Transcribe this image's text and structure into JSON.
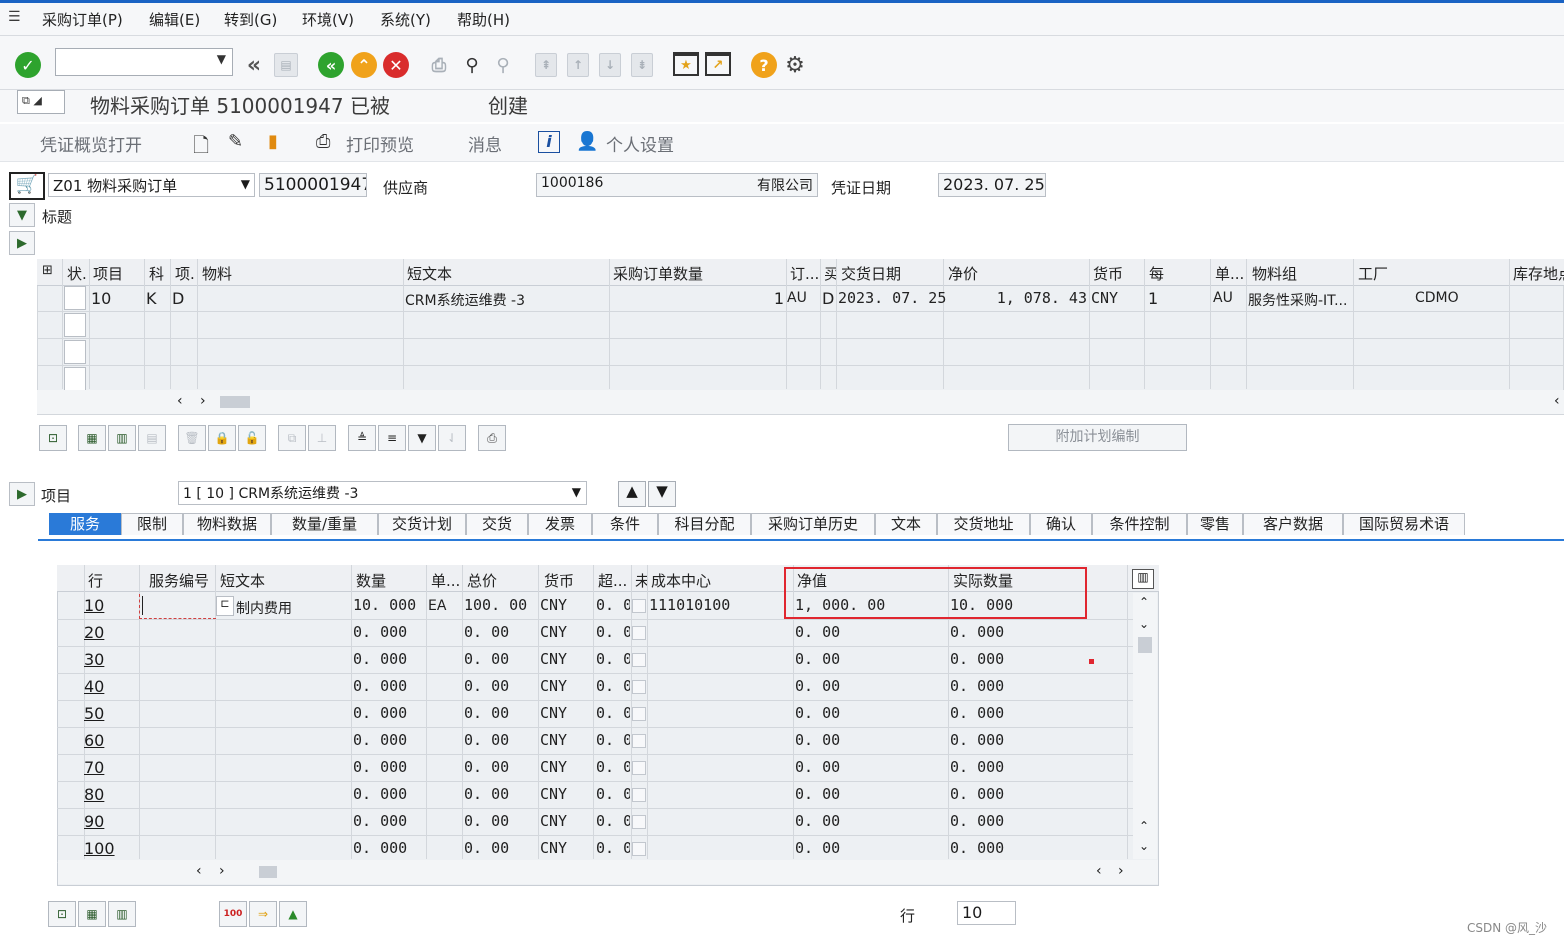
{
  "menu": [
    "采购订单(P)",
    "编辑(E)",
    "转到(G)",
    "环境(V)",
    "系统(Y)",
    "帮助(H)"
  ],
  "toolbar": {
    "icons": [
      "check-icon",
      "back-icon",
      "save-icon",
      "back-green-icon",
      "up-icon",
      "cancel-icon",
      "print-icon",
      "find-icon",
      "find-next-icon",
      "first-page-icon",
      "prev-page-icon",
      "next-page-icon",
      "last-page-icon",
      "create-session-icon",
      "shortcut-icon",
      "help-icon",
      "settings-icon"
    ],
    "command_value": ""
  },
  "title": {
    "prefix": "物料采购订单 5100001947 已被",
    "suffix": "创建"
  },
  "apptoolbar": {
    "doc_overview": "凭证概览打开",
    "print_preview": "打印预览",
    "messages": "消息",
    "personal_settings": "个人设置"
  },
  "header": {
    "order_type": "Z01 物料采购订单",
    "po_number": "5100001947",
    "vendor_label": "供应商",
    "vendor_value": "1000186",
    "vendor_name_tail": "有限公司",
    "doc_date_label": "凭证日期",
    "doc_date": "2023. 07. 25",
    "header_label": "标题"
  },
  "item_grid": {
    "columns": [
      "状.",
      "项目",
      "科",
      "项.",
      "物料",
      "短文本",
      "采购订单数量",
      "订...",
      "买",
      "交货日期",
      "净价",
      "货币",
      "每",
      "单...",
      "物料组",
      "工厂",
      "库存地点"
    ],
    "row": {
      "item": "10",
      "acct": "K",
      "itemcat": "D",
      "short_text": "CRM系统运维费 -3",
      "qty": "1",
      "unit": "AU",
      "date_cat": "D",
      "delivery_date": "2023. 07. 25",
      "net_price": "1, 078. 43",
      "currency": "CNY",
      "per": "1",
      "order_unit": "AU",
      "material_group": "服务性采购-IT...",
      "plant": "CDMO"
    },
    "extra_plan_button": "附加计划编制"
  },
  "item_detail": {
    "label": "项目",
    "selection": "1 [ 10 ] CRM系统运维费 -3",
    "tabs": [
      "服务",
      "限制",
      "物料数据",
      "数量/重量",
      "交货计划",
      "交货",
      "发票",
      "条件",
      "科目分配",
      "采购订单历史",
      "文本",
      "交货地址",
      "确认",
      "条件控制",
      "零售",
      "客户数据",
      "国际贸易术语"
    ],
    "active_tab": "服务"
  },
  "service_grid": {
    "columns": [
      "行",
      "服务编号",
      "短文本",
      "数量",
      "单...",
      "总价",
      "货币",
      "超...",
      "未",
      "成本中心",
      "净值",
      "实际数量"
    ],
    "rows": [
      {
        "line": "10",
        "short_text": "制内费用",
        "qty": "10. 000",
        "unit": "EA",
        "gross": "100. 00",
        "currency": "CNY",
        "over": "0. 0",
        "cost_center": "111010100",
        "net": "1, 000. 00",
        "actual_qty": "10. 000"
      },
      {
        "line": "20",
        "short_text": "",
        "qty": "0. 000",
        "unit": "",
        "gross": "0. 00",
        "currency": "CNY",
        "over": "0. 0",
        "cost_center": "",
        "net": "0. 00",
        "actual_qty": "0. 000"
      },
      {
        "line": "30",
        "short_text": "",
        "qty": "0. 000",
        "unit": "",
        "gross": "0. 00",
        "currency": "CNY",
        "over": "0. 0",
        "cost_center": "",
        "net": "0. 00",
        "actual_qty": "0. 000"
      },
      {
        "line": "40",
        "short_text": "",
        "qty": "0. 000",
        "unit": "",
        "gross": "0. 00",
        "currency": "CNY",
        "over": "0. 0",
        "cost_center": "",
        "net": "0. 00",
        "actual_qty": "0. 000"
      },
      {
        "line": "50",
        "short_text": "",
        "qty": "0. 000",
        "unit": "",
        "gross": "0. 00",
        "currency": "CNY",
        "over": "0. 0",
        "cost_center": "",
        "net": "0. 00",
        "actual_qty": "0. 000"
      },
      {
        "line": "60",
        "short_text": "",
        "qty": "0. 000",
        "unit": "",
        "gross": "0. 00",
        "currency": "CNY",
        "over": "0. 0",
        "cost_center": "",
        "net": "0. 00",
        "actual_qty": "0. 000"
      },
      {
        "line": "70",
        "short_text": "",
        "qty": "0. 000",
        "unit": "",
        "gross": "0. 00",
        "currency": "CNY",
        "over": "0. 0",
        "cost_center": "",
        "net": "0. 00",
        "actual_qty": "0. 000"
      },
      {
        "line": "80",
        "short_text": "",
        "qty": "0. 000",
        "unit": "",
        "gross": "0. 00",
        "currency": "CNY",
        "over": "0. 0",
        "cost_center": "",
        "net": "0. 00",
        "actual_qty": "0. 000"
      },
      {
        "line": "90",
        "short_text": "",
        "qty": "0. 000",
        "unit": "",
        "gross": "0. 00",
        "currency": "CNY",
        "over": "0. 0",
        "cost_center": "",
        "net": "0. 00",
        "actual_qty": "0. 000"
      },
      {
        "line": "100",
        "short_text": "",
        "qty": "0. 000",
        "unit": "",
        "gross": "0. 00",
        "currency": "CNY",
        "over": "0. 0",
        "cost_center": "",
        "net": "0. 00",
        "actual_qty": "0. 000"
      }
    ],
    "highlight_color": "#e0262f"
  },
  "footer": {
    "row_label": "行",
    "row_value": "10",
    "watermark": "CSDN @风_沙"
  }
}
